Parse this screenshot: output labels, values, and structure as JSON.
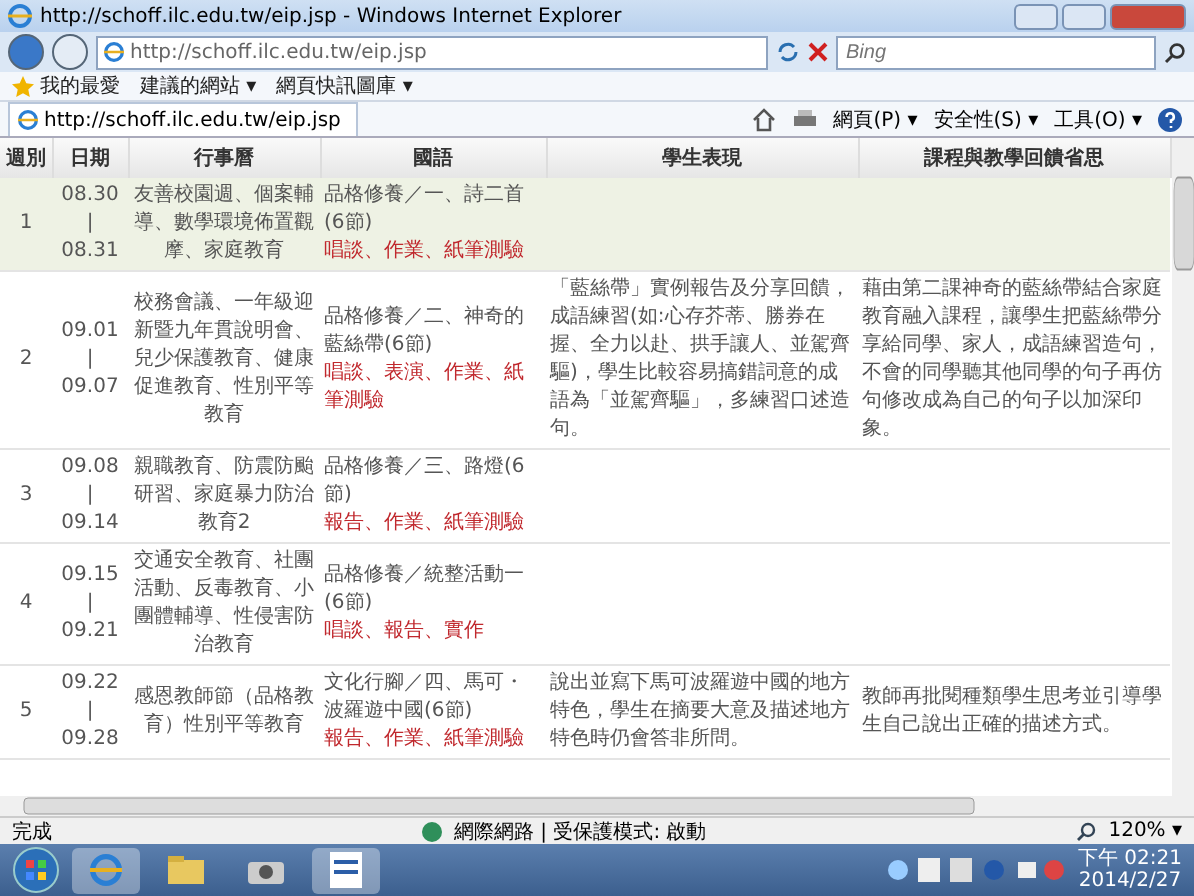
{
  "window": {
    "title": "http://schoff.ilc.edu.tw/eip.jsp - Windows Internet Explorer"
  },
  "address_bar": {
    "value": "http://schoff.ilc.edu.tw/eip.jsp",
    "search_placeholder": "Bing"
  },
  "favorites_bar": {
    "favorites": "我的最愛",
    "items": [
      {
        "label": "建議的網站 ▾"
      },
      {
        "label": "網頁快訊圖庫 ▾"
      }
    ]
  },
  "tab": {
    "label": "http://schoff.ilc.edu.tw/eip.jsp"
  },
  "command_bar": [
    "網頁(P) ▾",
    "安全性(S) ▾",
    "工具(O) ▾"
  ],
  "table": {
    "columns": [
      "週別",
      "日期",
      "行事曆",
      "國語",
      "學生表現",
      "課程與教學回饋省思"
    ],
    "rows": [
      {
        "week": "1",
        "start": "08.30",
        "sep": "|",
        "end": "08.31",
        "events": "友善校園週、個案輔導、數學環境佈置觀摩、家庭教育",
        "unit": "品格修養／一、詩二首(6節)",
        "assessment": "唱談、作業、紙筆測驗",
        "highlighted": true
      },
      {
        "week": "2",
        "start": "09.01",
        "sep": "|",
        "end": "09.07",
        "events": "校務會議、一年級迎新暨九年貫說明會、兒少保護教育、健康促進教育、性別平等教育",
        "unit": "品格修養／二、神奇的藍絲帶(6節)",
        "assessment": "唱談、表演、作業、紙筆測驗",
        "performance": "「藍絲帶」實例報告及分享回饋，成語練習(如:心存芥蒂、勝券在握、全力以赴、拱手讓人、並駕齊驅)，學生比較容易搞錯詞意的成語為「並駕齊驅」，多練習口述造句。",
        "reflection": "藉由第二課神奇的藍絲帶結合家庭教育融入課程，讓學生把藍絲帶分享給同學、家人，成語練習造句，不會的同學聽其他同學的句子再仿句修改成為自己的句子以加深印象。",
        "highlighted": false
      },
      {
        "week": "3",
        "start": "09.08",
        "sep": "|",
        "end": "09.14",
        "events": "親職教育、防震防颱研習、家庭暴力防治教育2",
        "unit": "品格修養／三、路燈(6節)",
        "assessment": "報告、作業、紙筆測驗",
        "highlighted": false
      },
      {
        "week": "4",
        "start": "09.15",
        "sep": "|",
        "end": "09.21",
        "events": "交通安全教育、社團活動、反毒教育、小團體輔導、性侵害防治教育",
        "unit": "品格修養／統整活動一(6節)",
        "assessment": "唱談、報告、實作",
        "highlighted": false
      },
      {
        "week": "5",
        "start": "09.22",
        "sep": "|",
        "end": "09.28",
        "events": "感恩教師節（品格教育）性別平等教育",
        "unit": "文化行腳／四、馬可・波羅遊中國(6節)",
        "assessment": "報告、作業、紙筆測驗",
        "performance": "說出並寫下馬可波羅遊中國的地方特色，學生在摘要大意及描述地方特色時仍會答非所問。",
        "reflection": "教師再批閱種類學生思考並引導學生自己說出正確的描述方式。",
        "highlighted": false
      }
    ]
  },
  "status_bar": {
    "status": "完成",
    "zone": "網際網路 | 受保護模式: 啟動",
    "zoom": "120% ▾"
  },
  "taskbar": {
    "time": "下午 02:21",
    "date": "2014/2/27"
  }
}
